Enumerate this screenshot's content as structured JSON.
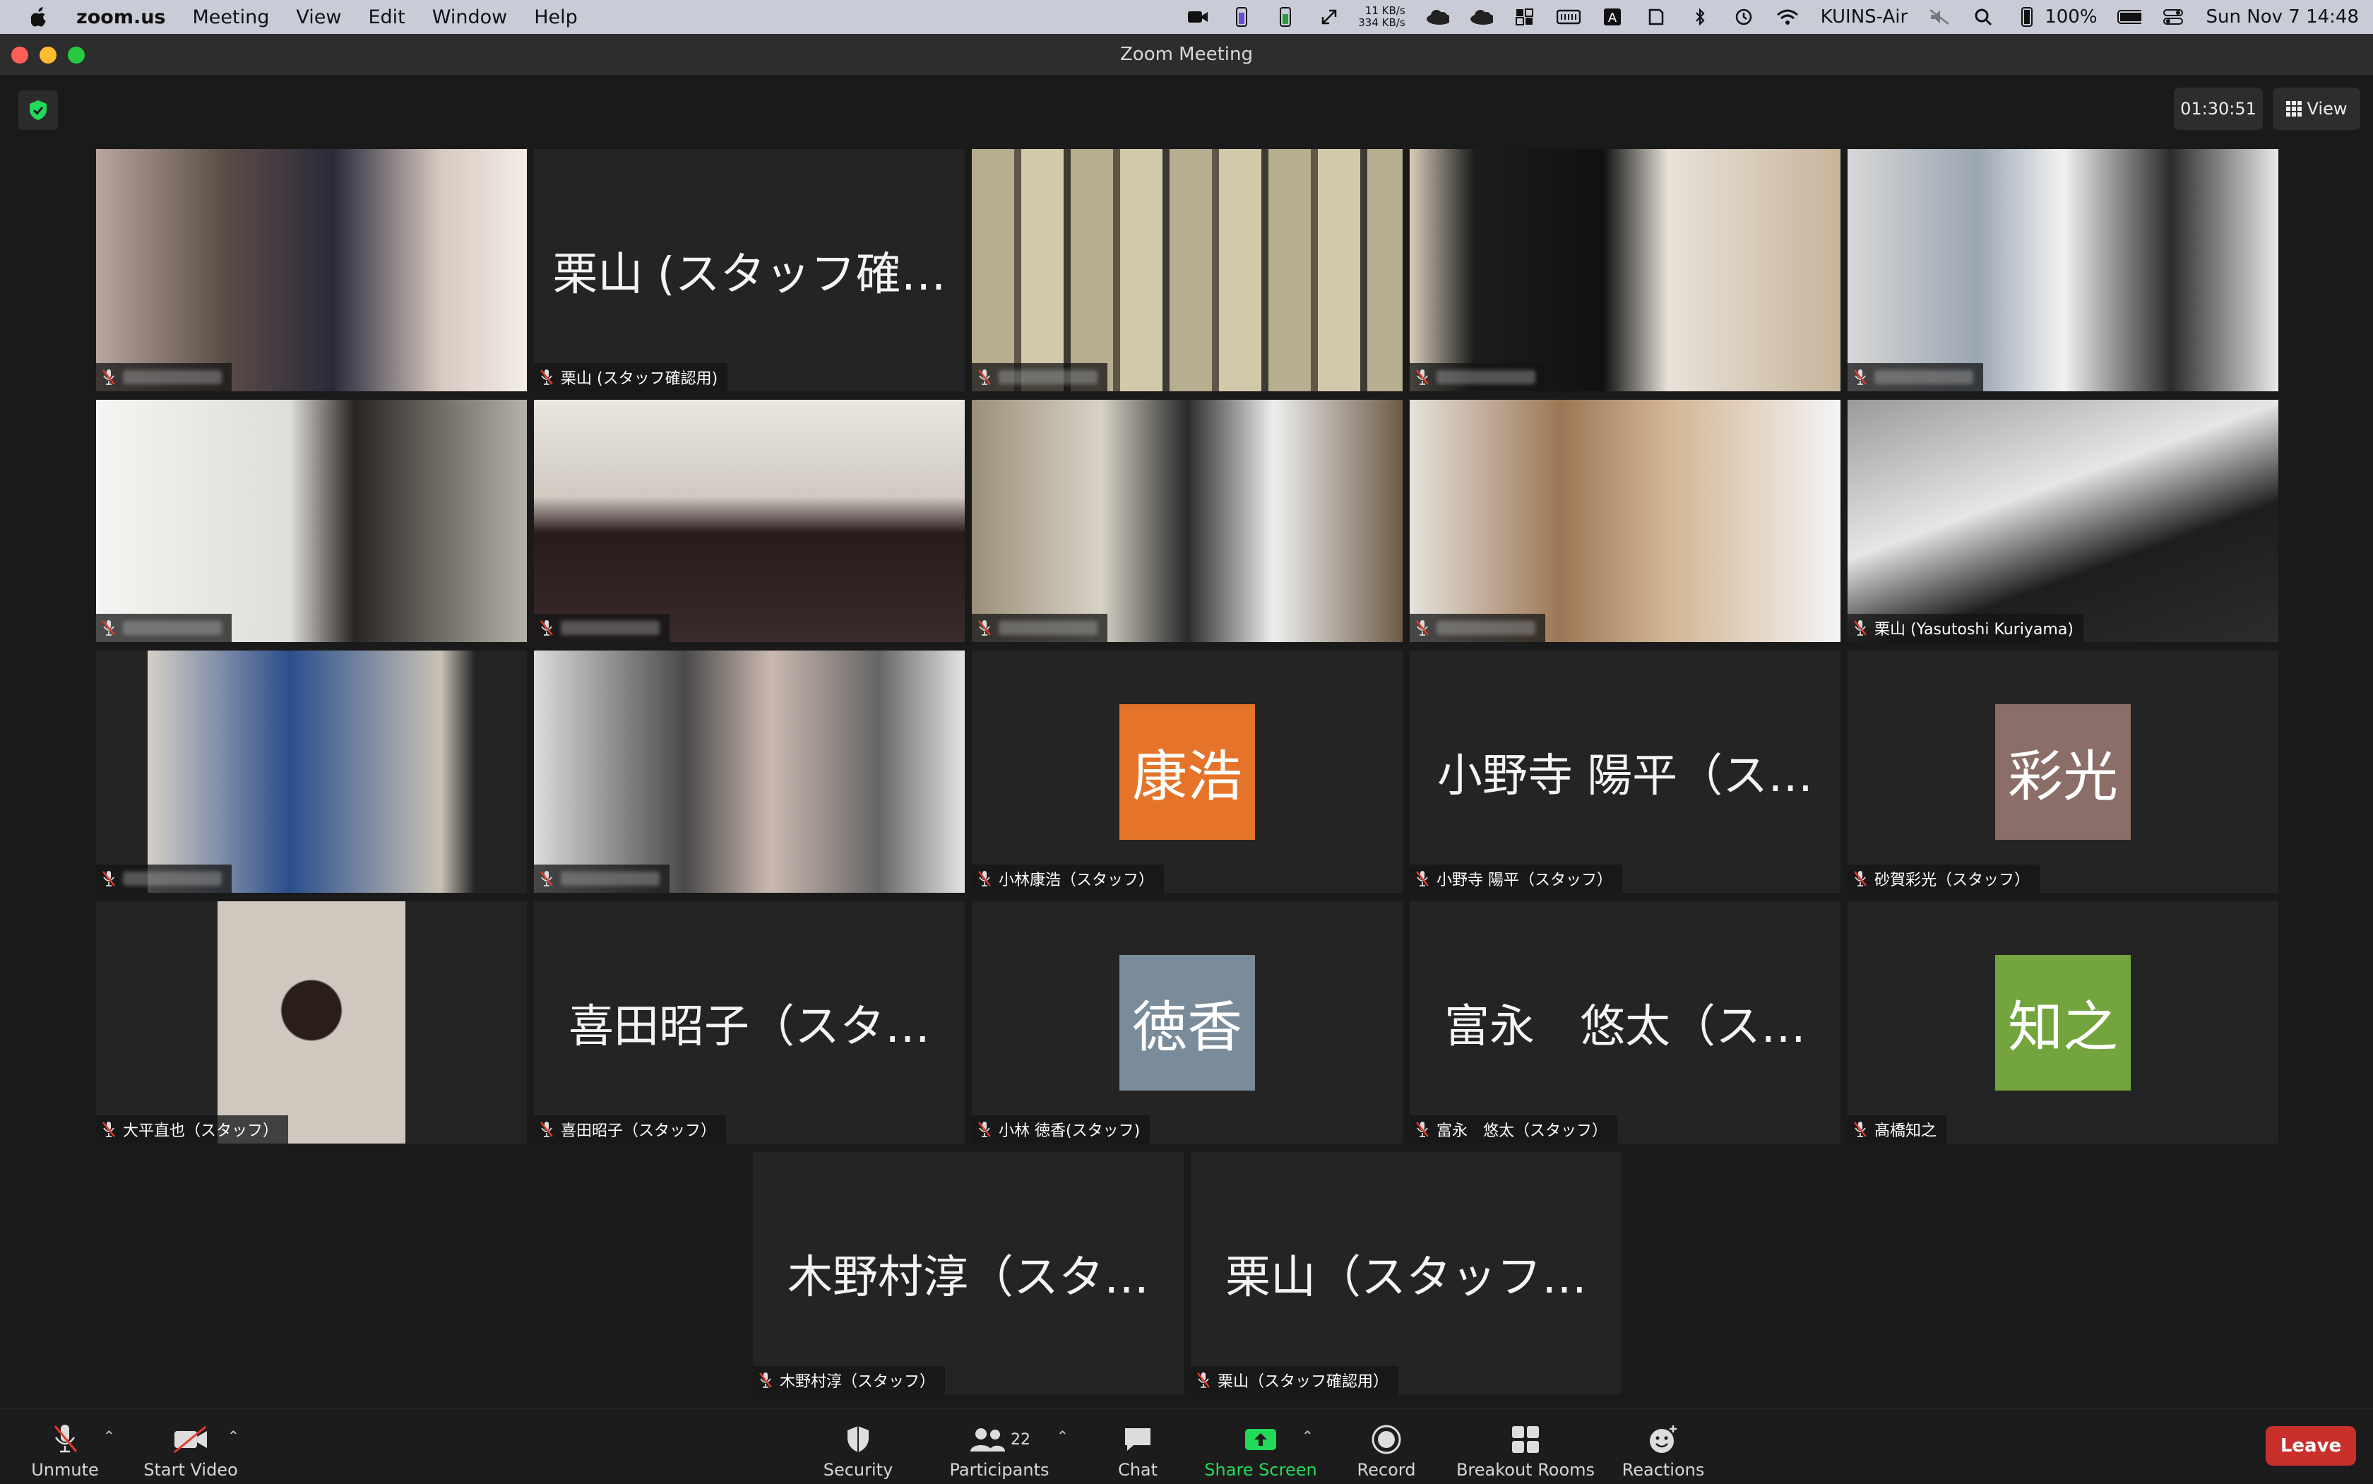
{
  "menubar": {
    "items": [
      "zoom.us",
      "Meeting",
      "View",
      "Edit",
      "Window",
      "Help"
    ],
    "net_up": "11 KB/s",
    "net_down": "334 KB/s",
    "hostname": "KUINS-Air",
    "battery": "100%",
    "clock": "Sun Nov 7  14:48"
  },
  "window": {
    "title": "Zoom Meeting"
  },
  "meeting": {
    "timer": "01:30:51",
    "view_label": "View"
  },
  "tiles": [
    {
      "kind": "video",
      "label": "",
      "scene": "boy"
    },
    {
      "kind": "text",
      "big": "栗山 (スタッフ確…",
      "label": "栗山 (スタッフ確認用)"
    },
    {
      "kind": "video",
      "label": "",
      "scene": "wall"
    },
    {
      "kind": "video",
      "label": "",
      "scene": "paper"
    },
    {
      "kind": "video",
      "label": "",
      "scene": "mask"
    },
    {
      "kind": "video",
      "label": "",
      "scene": "bright"
    },
    {
      "kind": "video",
      "label": "",
      "scene": "shelf"
    },
    {
      "kind": "video",
      "label": "",
      "scene": "window"
    },
    {
      "kind": "video",
      "label": "",
      "scene": "room"
    },
    {
      "kind": "video",
      "label": "栗山 (Yasutoshi Kuriyama)",
      "scene": "desk",
      "active": true
    },
    {
      "kind": "video",
      "label": "",
      "scene": "blue"
    },
    {
      "kind": "video",
      "label": "",
      "scene": "two"
    },
    {
      "kind": "avatar",
      "avatar": "康浩",
      "color": "#e5742a",
      "label": "小林康浩（スタッフ）"
    },
    {
      "kind": "text",
      "big": "小野寺 陽平（ス…",
      "label": "小野寺 陽平（スタッフ）"
    },
    {
      "kind": "avatar",
      "avatar": "彩光",
      "color": "#8b6e67",
      "label": "砂賀彩光（スタッフ）"
    },
    {
      "kind": "video",
      "label": "大平直也（スタッフ）",
      "scene": "man"
    },
    {
      "kind": "text",
      "big": "喜田昭子（スタ…",
      "label": "喜田昭子（スタッフ）"
    },
    {
      "kind": "avatar",
      "avatar": "徳香",
      "color": "#7a8c99",
      "label": "小林 徳香(スタッフ)"
    },
    {
      "kind": "text",
      "big": "富永　悠太（ス…",
      "label": "富永　悠太（スタッフ）"
    },
    {
      "kind": "avatar",
      "avatar": "知之",
      "color": "#73a43e",
      "label": "髙橋知之"
    },
    {
      "kind": "text",
      "big": "木野村淳（スタ…",
      "label": "木野村淳（スタッフ）"
    },
    {
      "kind": "text",
      "big": "栗山（スタッフ…",
      "label": "栗山（スタッフ確認用）"
    }
  ],
  "toolbar": {
    "unmute": "Unmute",
    "start_video": "Start Video",
    "security": "Security",
    "participants": "Participants",
    "participants_count": "22",
    "chat": "Chat",
    "share_screen": "Share Screen",
    "record": "Record",
    "breakout_rooms": "Breakout Rooms",
    "reactions": "Reactions",
    "leave": "Leave"
  },
  "colors": {
    "accent_green": "#23d959",
    "leave_red": "#c9302c",
    "active_border": "#b9d97c"
  }
}
